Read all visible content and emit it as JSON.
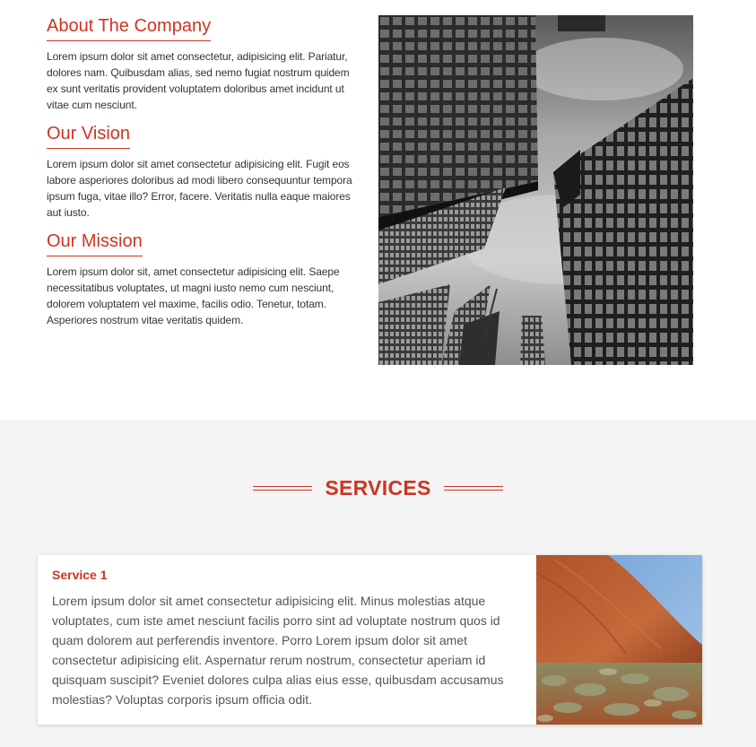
{
  "about": {
    "blocks": [
      {
        "heading": "About The Company",
        "body": "Lorem ipsum dolor sit amet consectetur, adipisicing elit. Pariatur, dolores nam. Quibusdam alias, sed nemo fugiat nostrum quidem ex sunt veritatis provident voluptatem doloribus amet incidunt ut vitae cum nesciunt."
      },
      {
        "heading": "Our Vision",
        "body": "Lorem ipsum dolor sit amet consectetur adipisicing elit. Fugit eos labore asperiores doloribus ad modi libero consequuntur tempora ipsum fuga, vitae illo? Error, facere. Veritatis nulla eaque maiores aut iusto."
      },
      {
        "heading": "Our Mission",
        "body": "Lorem ipsum dolor sit, amet consectetur adipisicing elit. Saepe necessitatibus voluptates, ut magni iusto nemo cum nesciunt, dolorem voluptatem vel maxime, facilis odio. Tenetur, totam. Asperiores nostrum vitae veritatis quidem."
      }
    ]
  },
  "services": {
    "title": "SERVICES",
    "cards": [
      {
        "name": "Service 1",
        "description": "Lorem ipsum dolor sit amet consectetur adipisicing elit. Minus molestias atque voluptates, cum iste amet nesciunt facilis porro sint ad voluptate nostrum quos id quam dolorem aut perferendis inventore. Porro Lorem ipsum dolor sit amet consectetur adipisicing elit. Aspernatur rerum nostrum, consectetur aperiam id quisquam suscipit? Eveniet dolores culpa alias eius esse, quibusdam accusamus molestias? Voluptas corporis ipsum officia odit."
      }
    ]
  },
  "colors": {
    "accent": "#cf3422",
    "section_bg": "#f4f4f4",
    "body_text": "#333333"
  }
}
